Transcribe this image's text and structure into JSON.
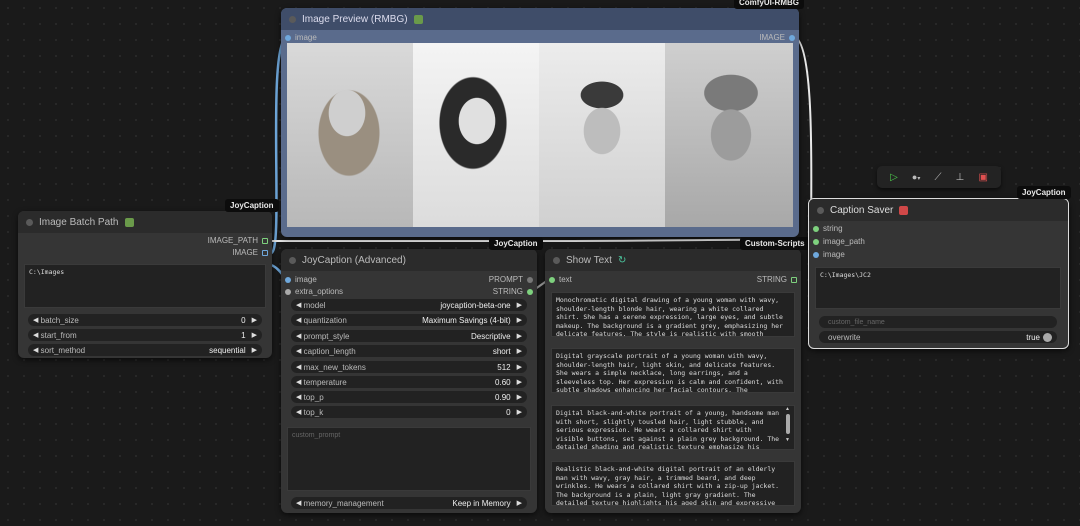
{
  "tags": {
    "comfy_rmbg": "ComfyUI-RMBG",
    "joycaption_batch": "JoyCaption",
    "joycaption_mid": "JoyCaption",
    "custom_scripts": "Custom-Scripts",
    "joycaption_saver": "JoyCaption"
  },
  "preview_node": {
    "title": "Image Preview (RMBG)",
    "input": "image",
    "output": "IMAGE"
  },
  "batch_node": {
    "title": "Image Batch Path",
    "outputs": [
      "IMAGE_PATH",
      "IMAGE"
    ],
    "path": "C:\\Images",
    "widgets": [
      {
        "label": "batch_size",
        "value": "0"
      },
      {
        "label": "start_from",
        "value": "1"
      },
      {
        "label": "sort_method",
        "value": "sequential"
      }
    ]
  },
  "adv_node": {
    "title": "JoyCaption (Advanced)",
    "inputs": [
      "image",
      "extra_options"
    ],
    "outputs": [
      "PROMPT",
      "STRING"
    ],
    "widgets": [
      {
        "label": "model",
        "value": "joycaption-beta-one"
      },
      {
        "label": "quantization",
        "value": "Maximum Savings (4-bit)"
      },
      {
        "label": "prompt_style",
        "value": "Descriptive"
      },
      {
        "label": "caption_length",
        "value": "short"
      },
      {
        "label": "max_new_tokens",
        "value": "512"
      },
      {
        "label": "temperature",
        "value": "0.60"
      },
      {
        "label": "top_p",
        "value": "0.90"
      },
      {
        "label": "top_k",
        "value": "0"
      }
    ],
    "custom_prompt_placeholder": "custom_prompt",
    "memory": {
      "label": "memory_management",
      "value": "Keep in Memory"
    }
  },
  "show_node": {
    "title": "Show Text",
    "input": "text",
    "output": "STRING",
    "texts": [
      "Monochromatic digital drawing of a young woman with wavy, shoulder-length blonde hair, wearing a white collared shirt. She has a serene expression, large eyes, and subtle makeup. The background is a gradient grey, emphasizing her delicate features. The style is realistic with smooth textures and fine lines.",
      "Digital grayscale portrait of a young woman with wavy, shoulder-length hair, light skin, and delicate features. She wears a simple necklace, long earrings, and a sleeveless top. Her expression is calm and confident, with subtle shadows enhancing her facial contours. The background is a smooth gradient.",
      "Digital black-and-white portrait of a young, handsome man with short, slightly tousled hair, light stubble, and serious expression. He wears a collared shirt with visible buttons, set against a plain grey background. The detailed shading and realistic texture emphasize his facial features and subtle skin texture.",
      "Realistic black-and-white digital portrait of an elderly man with wavy, gray hair, a trimmed beard, and deep wrinkles. He wears a collared shirt with a zip-up jacket. The background is a plain, light gray gradient. The detailed texture highlights his aged skin and expressive eyes, creating a lifelike, somber effect."
    ]
  },
  "saver_node": {
    "title": "Caption Saver",
    "inputs": [
      "string",
      "image_path",
      "image"
    ],
    "path": "C:\\Images\\JC2",
    "file_name_placeholder": "custom_file_name",
    "overwrite": {
      "label": "overwrite",
      "value": "true"
    }
  },
  "colors": {
    "preview_header": "#3f4d69",
    "link_white": "#e8e8e8",
    "link_blue": "#6fa8dc",
    "link_green": "#7ed17e"
  }
}
